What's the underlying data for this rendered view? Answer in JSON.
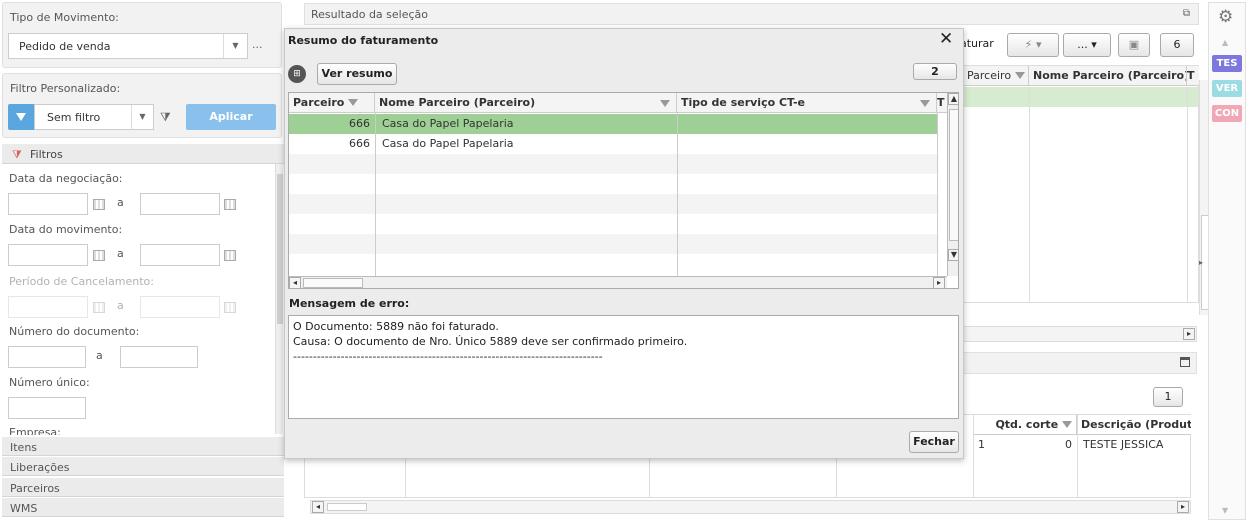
{
  "left": {
    "tipo_mov_label": "Tipo de Movimento:",
    "tipo_mov_value": "Pedido de venda",
    "more_btn": "...",
    "filtro_label": "Filtro Personalizado:",
    "filtro_value": "Sem filtro",
    "aplicar": "Aplicar",
    "filtros_header": "Filtros",
    "data_negociacao": "Data da negociação:",
    "a1": "a",
    "data_movimento": "Data do movimento:",
    "a2": "a",
    "periodo_cancel": "Período de Cancelamento:",
    "a3": "a",
    "numero_doc": "Número do documento:",
    "a4": "a",
    "numero_unico": "Número único:",
    "empresa": "Empresa:",
    "sections": [
      "Itens",
      "Liberações",
      "Parceiros",
      "WMS"
    ]
  },
  "main": {
    "resultado": "Resultado da seleção",
    "faturar": "aturar",
    "dots": "...",
    "count_top": "6",
    "col_parceiro": "Parceiro",
    "col_nome_parceiro": "Nome Parceiro (Parceiro)",
    "col_t": "T",
    "bottom_count": "1",
    "col_qtd": "Qtd. corte",
    "col_desc": "Descrição (Produto)",
    "bottom_row": {
      "c1": "1",
      "qtd": "0",
      "desc": "TESTE JESSICA"
    }
  },
  "tags": [
    "TES",
    "VER",
    "CON"
  ],
  "modal": {
    "title": "Resumo do faturamento",
    "ver_resumo": "Ver resumo",
    "count": "2",
    "columns": [
      "Parceiro",
      "Nome Parceiro (Parceiro)",
      "Tipo de serviço CT-e",
      "T"
    ],
    "rows": [
      {
        "parceiro": "666",
        "nome": "Casa do Papel Papelaria",
        "tipo": ""
      },
      {
        "parceiro": "666",
        "nome": "Casa do Papel Papelaria",
        "tipo": ""
      }
    ],
    "erro_label": "Mensagem de erro:",
    "erro_lines": [
      "O Documento: 5889 não foi faturado.",
      "Causa: O documento de Nro. Único 5889 deve ser confirmado primeiro.",
      "------------------------------------------------------------------------------"
    ],
    "fechar": "Fechar"
  }
}
